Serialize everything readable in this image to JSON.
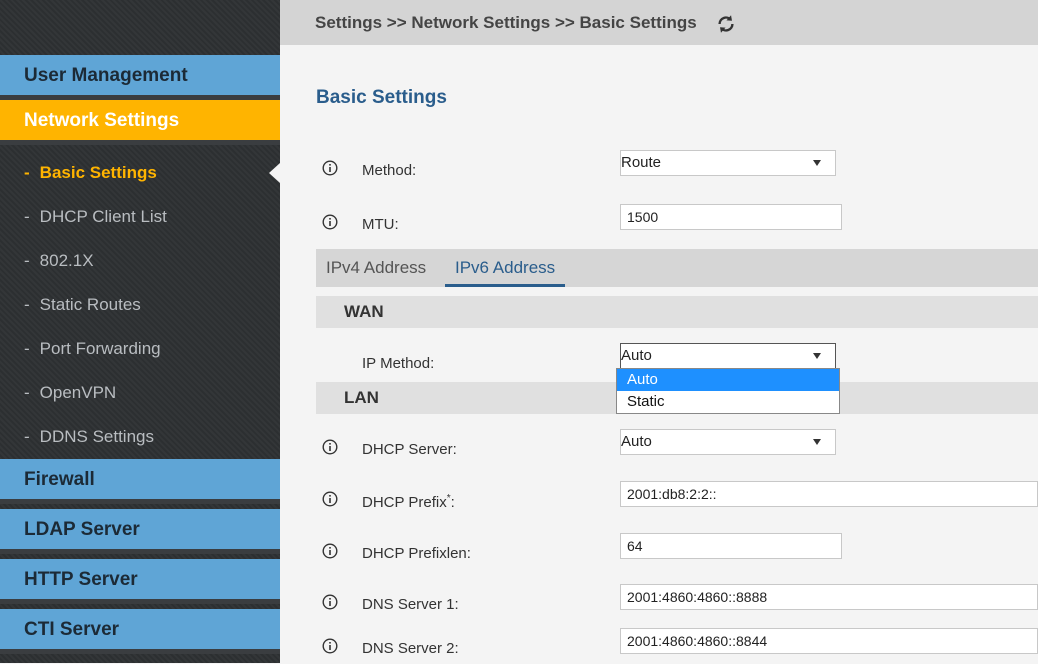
{
  "breadcrumb": "Settings >> Network Settings >> Basic Settings",
  "sidebar": {
    "main_items": [
      {
        "label": "User Management"
      },
      {
        "label": "Network Settings"
      },
      {
        "label": "Firewall"
      },
      {
        "label": "LDAP Server"
      },
      {
        "label": "HTTP Server"
      },
      {
        "label": "CTI Server"
      }
    ],
    "sub_items": [
      {
        "label": "Basic Settings"
      },
      {
        "label": "DHCP Client List"
      },
      {
        "label": "802.1X"
      },
      {
        "label": "Static Routes"
      },
      {
        "label": "Port Forwarding"
      },
      {
        "label": "OpenVPN"
      },
      {
        "label": "DDNS Settings"
      }
    ],
    "dash": "-",
    "active_main": "Network Settings",
    "active_sub": "Basic Settings"
  },
  "page": {
    "title": "Basic Settings"
  },
  "fields": {
    "method": {
      "label": "Method:",
      "value": "Route"
    },
    "mtu": {
      "label": "MTU:",
      "value": "1500"
    }
  },
  "tabs": [
    {
      "label": "IPv4 Address",
      "active": false
    },
    {
      "label": "IPv6 Address",
      "active": true
    }
  ],
  "wan": {
    "title": "WAN",
    "ip_method": {
      "label": "IP Method:",
      "value": "Auto",
      "options": [
        "Auto",
        "Static"
      ],
      "highlighted": "Auto"
    }
  },
  "lan": {
    "title": "LAN",
    "dhcp_server": {
      "label": "DHCP Server:",
      "value": "Auto"
    },
    "dhcp_prefix": {
      "label": "DHCP Prefix",
      "required_mark": "*",
      "suffix": ":",
      "value": "2001:db8:2:2::"
    },
    "dhcp_prefixlen": {
      "label": "DHCP Prefixlen:",
      "value": "64"
    },
    "dns_server_1": {
      "label": "DNS Server 1:",
      "value": "2001:4860:4860::8888"
    },
    "dns_server_2": {
      "label": "DNS Server 2:",
      "value": "2001:4860:4860::8844"
    }
  },
  "colors": {
    "accent": "#ffb400",
    "sidebar_blue": "#5fa5d6",
    "link_blue": "#2a5d8c",
    "highlight": "#1e90ff"
  },
  "icons": {
    "refresh": "refresh-icon",
    "info": "info-icon",
    "dropdown": "chevron-down-icon"
  }
}
